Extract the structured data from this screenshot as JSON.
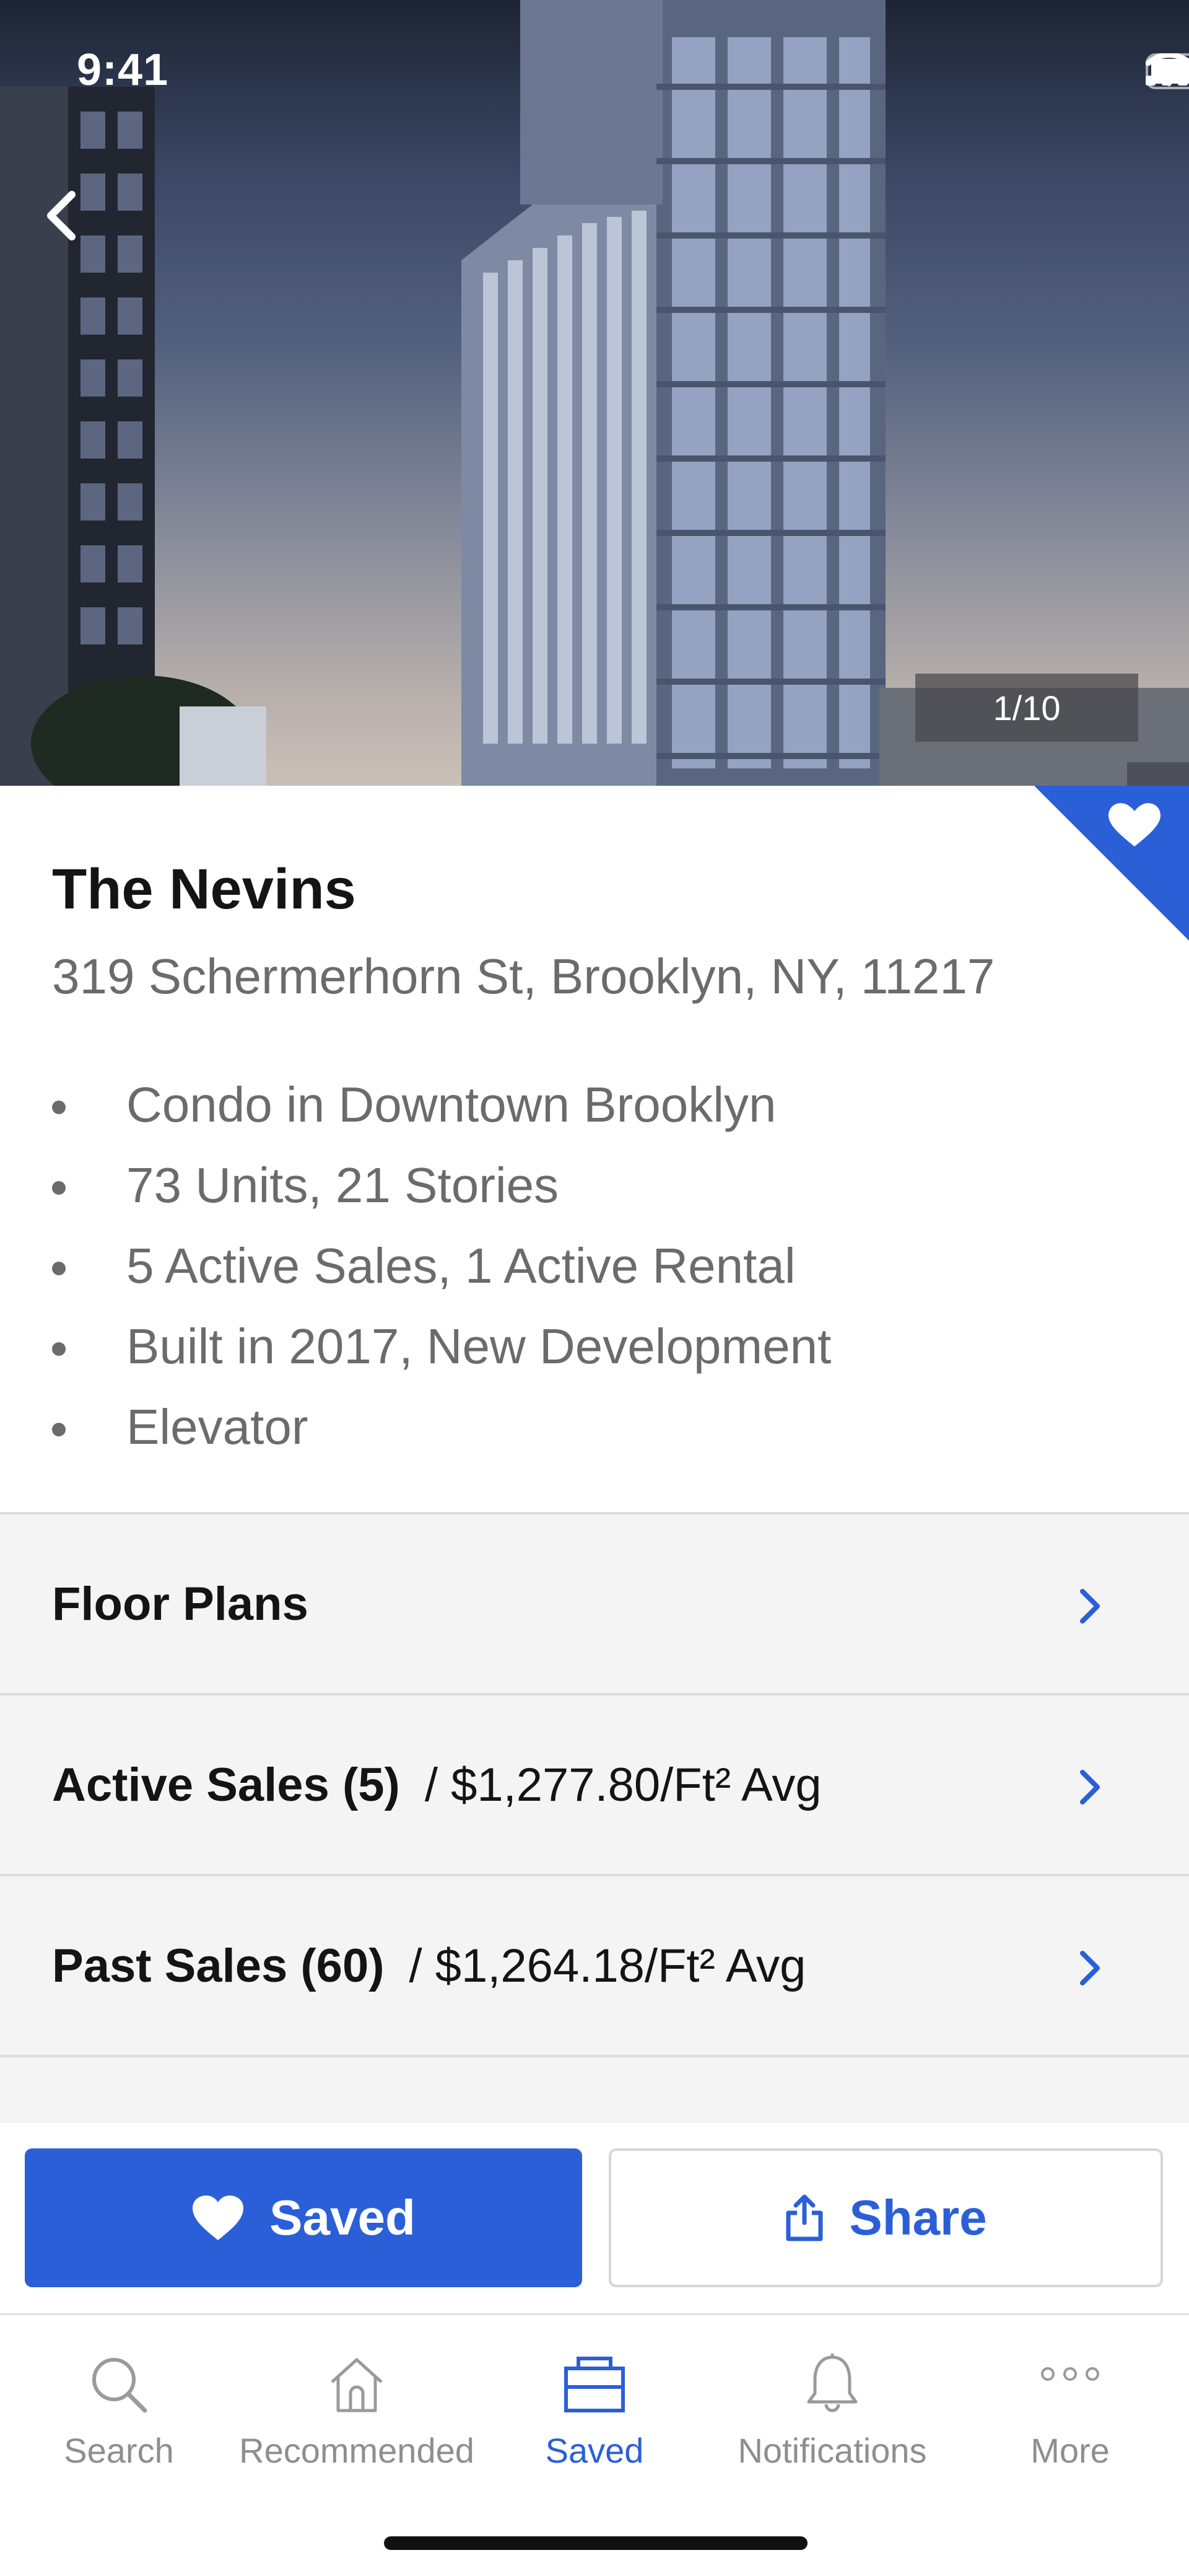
{
  "status_bar": {
    "time": "9:41"
  },
  "hero": {
    "photo_counter": "1/10"
  },
  "building": {
    "name": "The Nevins",
    "address": "319 Schermerhorn St, Brooklyn, NY, 11217",
    "facts": [
      "Condo in Downtown Brooklyn",
      "73 Units, 21 Stories",
      "5 Active Sales, 1 Active Rental",
      "Built in 2017, New Development",
      "Elevator"
    ]
  },
  "rows": [
    {
      "label": "Floor Plans",
      "sub": ""
    },
    {
      "label": "Active Sales (5)",
      "sub": "/ $1,277.80/Ft² Avg"
    },
    {
      "label": "Past Sales (60)",
      "sub": "/ $1,264.18/Ft² Avg"
    }
  ],
  "actions": {
    "saved_label": "Saved",
    "share_label": "Share"
  },
  "tabs": [
    {
      "label": "Search",
      "icon": "search-icon"
    },
    {
      "label": "Recommended",
      "icon": "home-icon"
    },
    {
      "label": "Saved",
      "icon": "saved-icon",
      "active": true
    },
    {
      "label": "Notifications",
      "icon": "bell-icon"
    },
    {
      "label": "More",
      "icon": "more-icon"
    }
  ],
  "colors": {
    "accent": "#2a5fd8",
    "text": "#141414",
    "muted": "#6b6b6b",
    "row_bg": "#f4f4f4"
  }
}
